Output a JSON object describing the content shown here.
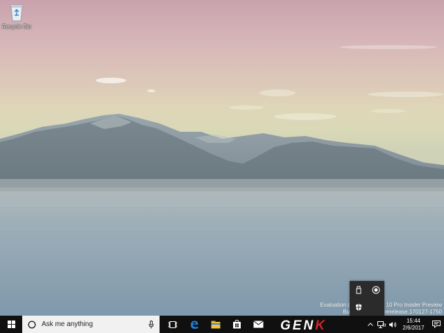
{
  "desktop": {
    "icons": [
      {
        "label": "Recycle Bin",
        "icon": "recycle-bin-icon"
      }
    ]
  },
  "watermark": {
    "line1": "Evaluation copy. Windows 10 Pro Insider Preview",
    "line2": "Build 15025.rs_prerelease.170127-1750"
  },
  "tray_flyout": {
    "icons": [
      "usb-drive-icon",
      "record-icon",
      "shield-icon"
    ]
  },
  "taskbar": {
    "start_icon": "windows-logo-icon",
    "search_placeholder": "Ask me anything",
    "search_icons": [
      "cortana-circle-icon",
      "microphone-icon"
    ],
    "pinned_apps": [
      "task-view-icon",
      "edge-icon",
      "file-explorer-icon",
      "store-icon",
      "mail-icon"
    ],
    "watermark_logo": "GENK",
    "tray_icons": [
      "chevron-up-icon",
      "network-icon",
      "volume-icon"
    ],
    "clock": {
      "time": "15:44",
      "date": "2/6/2017"
    },
    "action_center_icon": "notification-icon",
    "colors": {
      "taskbar": "#101010",
      "search_bg": "#f1f1f1",
      "edge_blue": "#1e7fd6",
      "genk_red": "#d2232a"
    }
  }
}
